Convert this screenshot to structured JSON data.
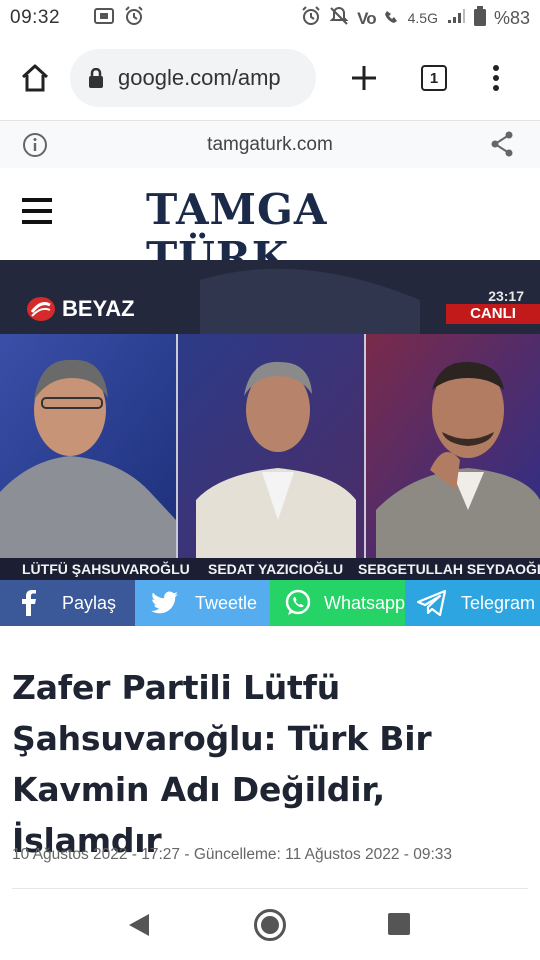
{
  "status_bar": {
    "time": "09:32",
    "network": "4.5G",
    "volte": "Vo",
    "battery": "%83"
  },
  "browser": {
    "url": "google.com/amp",
    "tab_count": "1"
  },
  "amp_header": {
    "domain": "tamgaturk.com"
  },
  "site": {
    "logo_text": "TAMGA TÜRK"
  },
  "hero": {
    "channel": "BEYAZ",
    "clock": "23:17",
    "live_label": "CANLI",
    "captions": [
      "LÜTFÜ ŞAHSUVAROĞLU",
      "SEDAT YAZICIOĞLU",
      "SEBGETULLAH SEYDAOĞLU"
    ]
  },
  "share": {
    "facebook": "Paylaş",
    "twitter": "Tweetle",
    "whatsapp": "Whatsapp",
    "telegram": "Telegram",
    "colors": {
      "facebook": "#3b5998",
      "twitter": "#55acee",
      "whatsapp": "#25d366",
      "telegram": "#2ca5e0"
    }
  },
  "article": {
    "title": "Zafer Partili Lütfü Şahsuvaroğlu: Türk Bir Kavmin Adı Değildir, İslamdır",
    "meta": "10 Ağustos 2022 - 17:27 - Güncelleme: 11 Ağustos 2022 - 09:33"
  }
}
